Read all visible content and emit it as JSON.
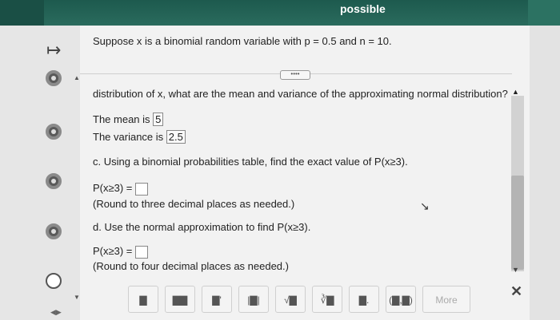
{
  "header": {
    "points_label": "possible"
  },
  "question": {
    "intro": "Suppose x is a binomial random variable with p = 0.5 and n = 10.",
    "part_b_prompt": "distribution of x, what are the mean and variance of the approximating normal distribution?",
    "mean_label": "The mean is",
    "mean_value": "5",
    "variance_label": "The variance is",
    "variance_value": "2.5",
    "part_c_prompt": "c. Using a binomial probabilities table, find the exact value of P(x≥3).",
    "part_c_answer_label": "P(x≥3) =",
    "part_c_hint": "(Round to three decimal places as needed.)",
    "part_d_prompt": "d. Use the normal approximation to find P(x≥3).",
    "part_d_answer_label": "P(x≥3) =",
    "part_d_hint": "(Round to four decimal places as needed.)"
  },
  "expand_button": {
    "label": "••••"
  },
  "toolbar": {
    "buttons": [
      "▇",
      "▇▇",
      "▇'",
      "|▇|",
      "√▇",
      "∛▇",
      "▇.",
      "(▇,▇)"
    ],
    "more_label": "More"
  },
  "icons": {
    "nav": "arrow-right-icon",
    "close": "close-icon",
    "cursor": "mouse-cursor-icon"
  }
}
